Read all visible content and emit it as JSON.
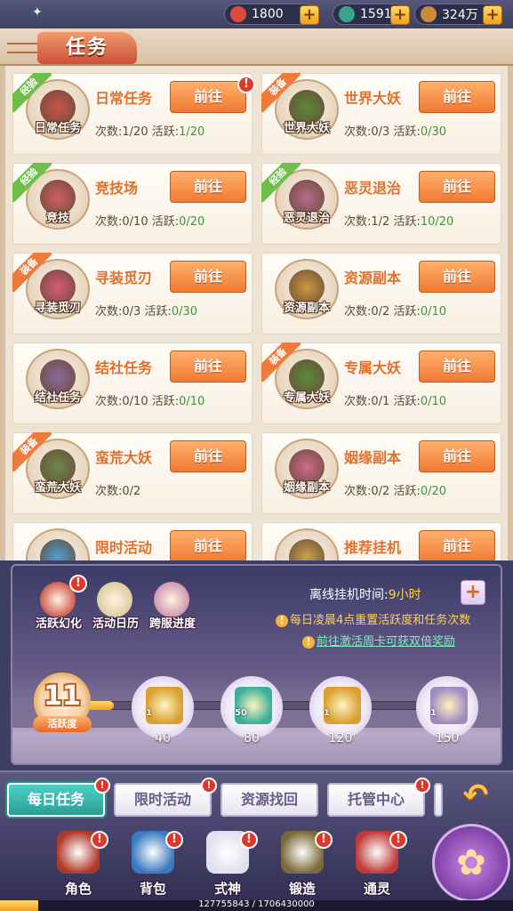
{
  "currencies": [
    {
      "id": "gold_ticket",
      "icon": "jade-icon",
      "value": "1800",
      "color": "#e04a3a"
    },
    {
      "id": "stamina",
      "icon": "lantern-icon",
      "value": "1591",
      "color": "#3aa58a"
    },
    {
      "id": "coins",
      "icon": "coin-icon",
      "value": "324万",
      "color": "#c98a3a"
    }
  ],
  "title": "任务",
  "tasks": [
    {
      "name": "日常任务",
      "icon_label": "日常任务",
      "ribbon": "经验",
      "ribbon_color": "green",
      "times": "1/20",
      "active": "1/20",
      "badge": "!",
      "button": "前往",
      "pic": "#c9554a"
    },
    {
      "name": "世界大妖",
      "icon_label": "世界大妖",
      "ribbon": "装备",
      "ribbon_color": "orange",
      "times": "0/3",
      "active": "0/30",
      "badge": "",
      "button": "前往",
      "pic": "#5a8a3a"
    },
    {
      "name": "竞技场",
      "icon_label": "竞技",
      "ribbon": "经验",
      "ribbon_color": "green",
      "times": "0/10",
      "active": "0/20",
      "badge": "",
      "button": "前往",
      "pic": "#d06060"
    },
    {
      "name": "恶灵退治",
      "icon_label": "恶灵退治",
      "ribbon": "经验",
      "ribbon_color": "green",
      "times": "1/2",
      "active": "10/20",
      "badge": "",
      "button": "前往",
      "pic": "#b86a8a"
    },
    {
      "name": "寻装觅刃",
      "icon_label": "寻装觅刃",
      "ribbon": "装备",
      "ribbon_color": "orange",
      "times": "0/3",
      "active": "0/30",
      "badge": "",
      "button": "前往",
      "pic": "#d85a7a"
    },
    {
      "name": "资源副本",
      "icon_label": "资源副本",
      "ribbon": "",
      "ribbon_color": "",
      "times": "0/2",
      "active": "0/10",
      "badge": "",
      "button": "前往",
      "pic": "#c99a3a"
    },
    {
      "name": "结社任务",
      "icon_label": "结社任务",
      "ribbon": "",
      "ribbon_color": "",
      "times": "0/10",
      "active": "0/10",
      "badge": "",
      "button": "前往",
      "pic": "#8a6a9a"
    },
    {
      "name": "专属大妖",
      "icon_label": "专属大妖",
      "ribbon": "装备",
      "ribbon_color": "orange",
      "times": "0/1",
      "active": "0/10",
      "badge": "",
      "button": "前往",
      "pic": "#5a8a3a"
    },
    {
      "name": "蛮荒大妖",
      "icon_label": "蛮荒大妖",
      "ribbon": "装备",
      "ribbon_color": "orange",
      "times": "0/2",
      "active": "",
      "badge": "",
      "button": "前往",
      "pic": "#6a8a4a"
    },
    {
      "name": "姻缘副本",
      "icon_label": "姻缘副本",
      "ribbon": "",
      "ribbon_color": "",
      "times": "0/2",
      "active": "0/20",
      "badge": "",
      "button": "前往",
      "pic": "#d06a8a"
    },
    {
      "name": "限时活动",
      "icon_label": "",
      "ribbon": "",
      "ribbon_color": "",
      "times": "",
      "active": "",
      "badge": "",
      "button": "前往",
      "pic": "#4aa0d0"
    },
    {
      "name": "推荐挂机",
      "icon_label": "",
      "ribbon": "",
      "ribbon_color": "",
      "times": "",
      "active": "",
      "badge": "",
      "button": "前往",
      "pic": "#c9a34a"
    }
  ],
  "labels": {
    "times": "次数:",
    "active": "活跃:"
  },
  "panel": {
    "icons": [
      {
        "label": "活跃幻化",
        "badge": "!",
        "color": "#c9453a"
      },
      {
        "label": "活动日历",
        "badge": "",
        "color": "#d8c89a"
      },
      {
        "label": "跨服进度",
        "badge": "",
        "color": "#c98aa8"
      }
    ],
    "offline_label": "离线挂机时间:",
    "offline_value": "9小时",
    "offline_plus": "+",
    "note1": "每日凌晨4点重置活跃度和任务次数",
    "note2": "前往激活周卡可获双倍奖励",
    "points_value": "11",
    "points_label": "活跃度",
    "progress": 0.0733,
    "rewards": [
      {
        "threshold": "40",
        "count": "1",
        "color": "#d9a030",
        "icon": "coin-bag-icon"
      },
      {
        "threshold": "80",
        "count": "50",
        "color": "#3ab09a",
        "icon": "jade-locked-icon"
      },
      {
        "threshold": "120",
        "count": "1",
        "color": "#d9a030",
        "icon": "coin-bag-icon"
      },
      {
        "threshold": "150",
        "count": "1",
        "color": "#a08ac0",
        "icon": "chest-icon"
      }
    ]
  },
  "tabs": [
    {
      "label": "每日任务",
      "active": true,
      "badge": "!"
    },
    {
      "label": "限时活动",
      "active": false,
      "badge": "!"
    },
    {
      "label": "资源找回",
      "active": false,
      "badge": ""
    },
    {
      "label": "托管中心",
      "active": false,
      "badge": "!"
    }
  ],
  "back_icon": "↶",
  "nav": [
    {
      "label": "角色",
      "badge": "!",
      "color": "#b03a2a"
    },
    {
      "label": "背包",
      "badge": "!",
      "color": "#3a7ac0"
    },
    {
      "label": "式神",
      "badge": "!",
      "color": "#e0e0f0"
    },
    {
      "label": "锻造",
      "badge": "!",
      "color": "#7a6a3a"
    },
    {
      "label": "通灵",
      "badge": "!",
      "color": "#c03a3a"
    }
  ],
  "exp": {
    "text": "127755843 / 1706430000",
    "progress": 0.0749
  }
}
